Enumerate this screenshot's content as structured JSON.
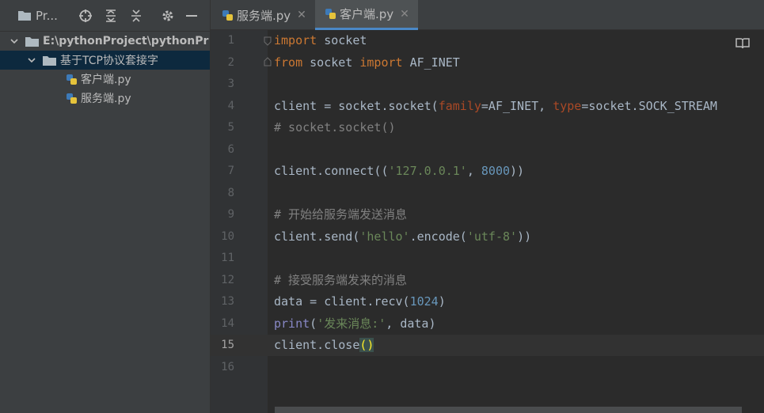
{
  "project_panel": {
    "title": "Pr...",
    "tree": {
      "root": "E:\\pythonProject\\pythonPr",
      "folder": "基于TCP协议套接字",
      "files": [
        "客户端.py",
        "服务端.py"
      ]
    }
  },
  "editor": {
    "tabs": [
      {
        "label": "服务端.py",
        "close": "✕"
      },
      {
        "label": "客户端.py",
        "close": "✕"
      }
    ],
    "line_numbers": [
      "1",
      "2",
      "3",
      "4",
      "5",
      "6",
      "7",
      "8",
      "9",
      "10",
      "11",
      "12",
      "13",
      "14",
      "15",
      "16"
    ],
    "current_line": 15,
    "code": {
      "l1": {
        "kw": "import",
        "rest": " socket"
      },
      "l2": {
        "kw1": "from",
        "mid": " socket ",
        "kw2": "import",
        "rest": " AF_INET"
      },
      "l4": {
        "a": "client = socket.socket(",
        "p1": "family",
        "b": "=AF_INET, ",
        "p2": "type",
        "c": "=socket.SOCK_STREAM"
      },
      "l5": "# socket.socket()",
      "l7": {
        "a": "client.connect((",
        "s": "'127.0.0.1'",
        "b": ", ",
        "n": "8000",
        "c": "))"
      },
      "l9": "# 开始给服务端发送消息",
      "l10": {
        "a": "client.send(",
        "s1": "'hello'",
        "b": ".encode(",
        "s2": "'utf-8'",
        "c": "))"
      },
      "l12": "# 接受服务端发来的消息",
      "l13": {
        "a": "data = client.recv(",
        "n": "1024",
        "c": ")"
      },
      "l14": {
        "f": "print",
        "a": "(",
        "s": "'发来消息:'",
        "c": ", data)"
      },
      "l15": {
        "a": "client.close",
        "br": "()"
      }
    }
  },
  "colors": {
    "background": "#2b2b2b",
    "keyword": "#cc7832",
    "string": "#6a8759",
    "number": "#6897bb",
    "comment": "#808080",
    "tab_accent": "#4a88c7"
  }
}
